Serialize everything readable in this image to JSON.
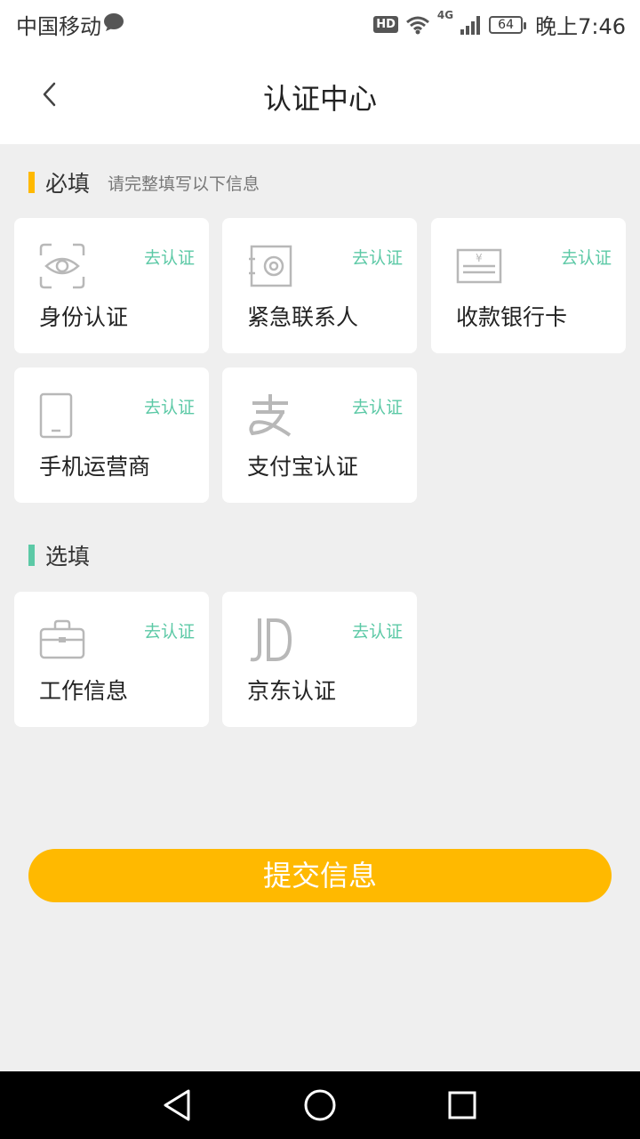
{
  "status": {
    "carrier": "中国移动",
    "hd": "HD",
    "network": "4G",
    "battery": "64",
    "time": "晚上7:46"
  },
  "header": {
    "title": "认证中心"
  },
  "required": {
    "label": "必填",
    "hint": "请完整填写以下信息",
    "accent": "#ffb900"
  },
  "optional": {
    "label": "选填",
    "accent": "#5cc9a6"
  },
  "cards": [
    {
      "name": "身份认证",
      "action": "去认证",
      "icon": "face-scan-icon"
    },
    {
      "name": "紧急联系人",
      "action": "去认证",
      "icon": "safe-icon"
    },
    {
      "name": "收款银行卡",
      "action": "去认证",
      "icon": "bank-card-icon"
    },
    {
      "name": "手机运营商",
      "action": "去认证",
      "icon": "phone-icon"
    },
    {
      "name": "支付宝认证",
      "action": "去认证",
      "icon": "alipay-icon"
    },
    {
      "name": "工作信息",
      "action": "去认证",
      "icon": "briefcase-icon"
    },
    {
      "name": "京东认证",
      "action": "去认证",
      "icon": "jd-icon"
    }
  ],
  "submit": {
    "label": "提交信息"
  },
  "colors": {
    "primary": "#ffb900",
    "action": "#5cc9a6",
    "background": "#efefef",
    "icon": "#b8b8b8"
  }
}
